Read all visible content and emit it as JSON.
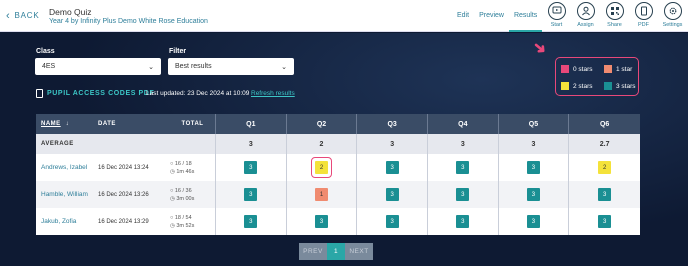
{
  "header": {
    "back_label": "BACK",
    "quiz_title": "Demo Quiz",
    "quiz_subtitle": "Year 4 by Infinity Plus Demo White Rose Education",
    "tabs": [
      "Edit",
      "Preview",
      "Results"
    ],
    "active_tab": "Results",
    "actions": [
      {
        "label": "Start",
        "icon": "play-icon"
      },
      {
        "label": "Assign",
        "icon": "user-icon"
      },
      {
        "label": "Share",
        "icon": "qr-code-icon"
      },
      {
        "label": "PDF",
        "icon": "document-icon"
      },
      {
        "label": "Settings",
        "icon": "gear-icon"
      }
    ]
  },
  "filters": {
    "class_label": "Class",
    "class_value": "4ES",
    "filter_label": "Filter",
    "filter_value": "Best results"
  },
  "legend": {
    "items": [
      {
        "label": "0 stars",
        "color": "#e8487a"
      },
      {
        "label": "1 star",
        "color": "#f08b70"
      },
      {
        "label": "2 stars",
        "color": "#f4e23a"
      },
      {
        "label": "3 stars",
        "color": "#1a8f93"
      }
    ]
  },
  "codes": {
    "pdf_label": "PUPIL ACCESS CODES PDF",
    "updated_text": "Last updated: 23 Dec 2024 at 10:09",
    "refresh_label": "Refresh results"
  },
  "table": {
    "headers": {
      "name": "NAME",
      "date": "DATE",
      "total": "TOTAL",
      "questions": [
        "Q1",
        "Q2",
        "Q3",
        "Q4",
        "Q5",
        "Q6"
      ]
    },
    "average_label": "AVERAGE",
    "averages": [
      "3",
      "2",
      "3",
      "3",
      "3",
      "2.7"
    ],
    "rows": [
      {
        "name": "Andrews, Izabel",
        "date": "16 Dec 2024 13:24",
        "score": "16 / 18",
        "time": "1m 46s",
        "scores": [
          "3",
          "2",
          "3",
          "3",
          "3",
          "2"
        ]
      },
      {
        "name": "Hamble, William",
        "date": "16 Dec 2024 13:26",
        "score": "16 / 36",
        "time": "3m 00s",
        "scores": [
          "3",
          "1",
          "3",
          "3",
          "3",
          "3"
        ]
      },
      {
        "name": "Jakub, Zofia",
        "date": "16 Dec 2024 13:29",
        "score": "18 / 54",
        "time": "3m 52s",
        "scores": [
          "3",
          "3",
          "3",
          "3",
          "3",
          "3"
        ]
      }
    ]
  },
  "pager": {
    "prev": "PREV",
    "page": "1",
    "next": "NEXT"
  }
}
